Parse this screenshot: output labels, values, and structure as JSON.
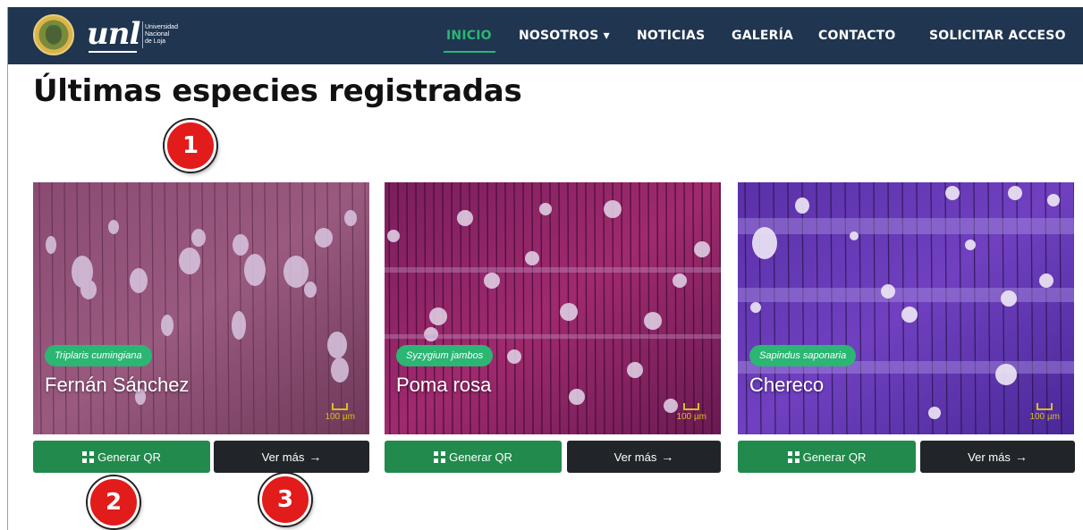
{
  "header": {
    "logo_text": "unl",
    "university_name": "Universidad\nNacional\nde Loja"
  },
  "nav": {
    "items": [
      {
        "label": "INICIO",
        "active": true
      },
      {
        "label": "NOSOTROS ▾",
        "active": false
      },
      {
        "label": "NOTICIAS",
        "active": false
      },
      {
        "label": "GALERÍA",
        "active": false
      },
      {
        "label": "CONTACTO",
        "active": false
      },
      {
        "label": "SOLICITAR ACCESO",
        "active": false
      }
    ]
  },
  "main": {
    "title": "Últimas especies registradas",
    "cards": [
      {
        "scientific_name": "Triplaris cumingiana",
        "common_name": "Fernán Sánchez",
        "scale": "100 µm",
        "qr_label": "Generar QR",
        "more_label": "Ver más",
        "image": "wood-cross-section-pink"
      },
      {
        "scientific_name": "Syzygium jambos",
        "common_name": "Poma rosa",
        "scale": "100 µm",
        "qr_label": "Generar QR",
        "more_label": "Ver más",
        "image": "wood-cross-section-magenta"
      },
      {
        "scientific_name": "Sapindus saponaria",
        "common_name": "Chereco",
        "scale": "100 µm",
        "qr_label": "Generar QR",
        "more_label": "Ver más",
        "image": "wood-cross-section-purple"
      }
    ]
  },
  "annotations": {
    "markers": [
      "1",
      "2",
      "3"
    ]
  },
  "colors": {
    "navbar": "#1f3550",
    "accent_green": "#2bb673",
    "qr_button": "#218a4c",
    "more_button": "#212529",
    "marker_red": "#e21b1b"
  }
}
